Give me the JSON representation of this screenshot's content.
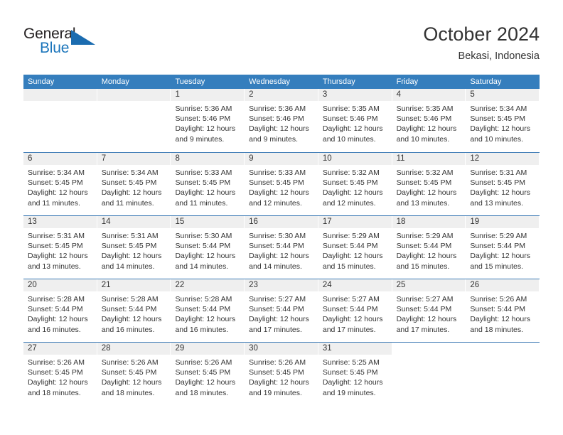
{
  "brand": {
    "name_top": "General",
    "name_bottom": "Blue",
    "triangle_icon": "triangle-icon",
    "color_dark": "#231f20",
    "color_blue": "#1b75bb"
  },
  "header": {
    "title": "October 2024",
    "subtitle": "Bekasi, Indonesia"
  },
  "theme": {
    "header_bg": "#357ebd",
    "header_text": "#ffffff",
    "row_divider": "#3f7cb6",
    "daynum_bg": "#efefef",
    "text": "#333333"
  },
  "calendar": {
    "weekday_headers": [
      "Sunday",
      "Monday",
      "Tuesday",
      "Wednesday",
      "Thursday",
      "Friday",
      "Saturday"
    ],
    "weeks": [
      [
        {
          "day": "",
          "empty": true,
          "sunrise": "",
          "sunset": "",
          "daylight_1": "",
          "daylight_2": ""
        },
        {
          "day": "",
          "empty": true,
          "sunrise": "",
          "sunset": "",
          "daylight_1": "",
          "daylight_2": ""
        },
        {
          "day": "1",
          "sunrise": "Sunrise: 5:36 AM",
          "sunset": "Sunset: 5:46 PM",
          "daylight_1": "Daylight: 12 hours",
          "daylight_2": "and 9 minutes."
        },
        {
          "day": "2",
          "sunrise": "Sunrise: 5:36 AM",
          "sunset": "Sunset: 5:46 PM",
          "daylight_1": "Daylight: 12 hours",
          "daylight_2": "and 9 minutes."
        },
        {
          "day": "3",
          "sunrise": "Sunrise: 5:35 AM",
          "sunset": "Sunset: 5:46 PM",
          "daylight_1": "Daylight: 12 hours",
          "daylight_2": "and 10 minutes."
        },
        {
          "day": "4",
          "sunrise": "Sunrise: 5:35 AM",
          "sunset": "Sunset: 5:46 PM",
          "daylight_1": "Daylight: 12 hours",
          "daylight_2": "and 10 minutes."
        },
        {
          "day": "5",
          "sunrise": "Sunrise: 5:34 AM",
          "sunset": "Sunset: 5:45 PM",
          "daylight_1": "Daylight: 12 hours",
          "daylight_2": "and 10 minutes."
        }
      ],
      [
        {
          "day": "6",
          "sunrise": "Sunrise: 5:34 AM",
          "sunset": "Sunset: 5:45 PM",
          "daylight_1": "Daylight: 12 hours",
          "daylight_2": "and 11 minutes."
        },
        {
          "day": "7",
          "sunrise": "Sunrise: 5:34 AM",
          "sunset": "Sunset: 5:45 PM",
          "daylight_1": "Daylight: 12 hours",
          "daylight_2": "and 11 minutes."
        },
        {
          "day": "8",
          "sunrise": "Sunrise: 5:33 AM",
          "sunset": "Sunset: 5:45 PM",
          "daylight_1": "Daylight: 12 hours",
          "daylight_2": "and 11 minutes."
        },
        {
          "day": "9",
          "sunrise": "Sunrise: 5:33 AM",
          "sunset": "Sunset: 5:45 PM",
          "daylight_1": "Daylight: 12 hours",
          "daylight_2": "and 12 minutes."
        },
        {
          "day": "10",
          "sunrise": "Sunrise: 5:32 AM",
          "sunset": "Sunset: 5:45 PM",
          "daylight_1": "Daylight: 12 hours",
          "daylight_2": "and 12 minutes."
        },
        {
          "day": "11",
          "sunrise": "Sunrise: 5:32 AM",
          "sunset": "Sunset: 5:45 PM",
          "daylight_1": "Daylight: 12 hours",
          "daylight_2": "and 13 minutes."
        },
        {
          "day": "12",
          "sunrise": "Sunrise: 5:31 AM",
          "sunset": "Sunset: 5:45 PM",
          "daylight_1": "Daylight: 12 hours",
          "daylight_2": "and 13 minutes."
        }
      ],
      [
        {
          "day": "13",
          "sunrise": "Sunrise: 5:31 AM",
          "sunset": "Sunset: 5:45 PM",
          "daylight_1": "Daylight: 12 hours",
          "daylight_2": "and 13 minutes."
        },
        {
          "day": "14",
          "sunrise": "Sunrise: 5:31 AM",
          "sunset": "Sunset: 5:45 PM",
          "daylight_1": "Daylight: 12 hours",
          "daylight_2": "and 14 minutes."
        },
        {
          "day": "15",
          "sunrise": "Sunrise: 5:30 AM",
          "sunset": "Sunset: 5:44 PM",
          "daylight_1": "Daylight: 12 hours",
          "daylight_2": "and 14 minutes."
        },
        {
          "day": "16",
          "sunrise": "Sunrise: 5:30 AM",
          "sunset": "Sunset: 5:44 PM",
          "daylight_1": "Daylight: 12 hours",
          "daylight_2": "and 14 minutes."
        },
        {
          "day": "17",
          "sunrise": "Sunrise: 5:29 AM",
          "sunset": "Sunset: 5:44 PM",
          "daylight_1": "Daylight: 12 hours",
          "daylight_2": "and 15 minutes."
        },
        {
          "day": "18",
          "sunrise": "Sunrise: 5:29 AM",
          "sunset": "Sunset: 5:44 PM",
          "daylight_1": "Daylight: 12 hours",
          "daylight_2": "and 15 minutes."
        },
        {
          "day": "19",
          "sunrise": "Sunrise: 5:29 AM",
          "sunset": "Sunset: 5:44 PM",
          "daylight_1": "Daylight: 12 hours",
          "daylight_2": "and 15 minutes."
        }
      ],
      [
        {
          "day": "20",
          "sunrise": "Sunrise: 5:28 AM",
          "sunset": "Sunset: 5:44 PM",
          "daylight_1": "Daylight: 12 hours",
          "daylight_2": "and 16 minutes."
        },
        {
          "day": "21",
          "sunrise": "Sunrise: 5:28 AM",
          "sunset": "Sunset: 5:44 PM",
          "daylight_1": "Daylight: 12 hours",
          "daylight_2": "and 16 minutes."
        },
        {
          "day": "22",
          "sunrise": "Sunrise: 5:28 AM",
          "sunset": "Sunset: 5:44 PM",
          "daylight_1": "Daylight: 12 hours",
          "daylight_2": "and 16 minutes."
        },
        {
          "day": "23",
          "sunrise": "Sunrise: 5:27 AM",
          "sunset": "Sunset: 5:44 PM",
          "daylight_1": "Daylight: 12 hours",
          "daylight_2": "and 17 minutes."
        },
        {
          "day": "24",
          "sunrise": "Sunrise: 5:27 AM",
          "sunset": "Sunset: 5:44 PM",
          "daylight_1": "Daylight: 12 hours",
          "daylight_2": "and 17 minutes."
        },
        {
          "day": "25",
          "sunrise": "Sunrise: 5:27 AM",
          "sunset": "Sunset: 5:44 PM",
          "daylight_1": "Daylight: 12 hours",
          "daylight_2": "and 17 minutes."
        },
        {
          "day": "26",
          "sunrise": "Sunrise: 5:26 AM",
          "sunset": "Sunset: 5:44 PM",
          "daylight_1": "Daylight: 12 hours",
          "daylight_2": "and 18 minutes."
        }
      ],
      [
        {
          "day": "27",
          "sunrise": "Sunrise: 5:26 AM",
          "sunset": "Sunset: 5:45 PM",
          "daylight_1": "Daylight: 12 hours",
          "daylight_2": "and 18 minutes."
        },
        {
          "day": "28",
          "sunrise": "Sunrise: 5:26 AM",
          "sunset": "Sunset: 5:45 PM",
          "daylight_1": "Daylight: 12 hours",
          "daylight_2": "and 18 minutes."
        },
        {
          "day": "29",
          "sunrise": "Sunrise: 5:26 AM",
          "sunset": "Sunset: 5:45 PM",
          "daylight_1": "Daylight: 12 hours",
          "daylight_2": "and 18 minutes."
        },
        {
          "day": "30",
          "sunrise": "Sunrise: 5:26 AM",
          "sunset": "Sunset: 5:45 PM",
          "daylight_1": "Daylight: 12 hours",
          "daylight_2": "and 19 minutes."
        },
        {
          "day": "31",
          "sunrise": "Sunrise: 5:25 AM",
          "sunset": "Sunset: 5:45 PM",
          "daylight_1": "Daylight: 12 hours",
          "daylight_2": "and 19 minutes."
        },
        {
          "day": "",
          "blank": true,
          "sunrise": "",
          "sunset": "",
          "daylight_1": "",
          "daylight_2": ""
        },
        {
          "day": "",
          "blank": true,
          "sunrise": "",
          "sunset": "",
          "daylight_1": "",
          "daylight_2": ""
        }
      ]
    ]
  }
}
